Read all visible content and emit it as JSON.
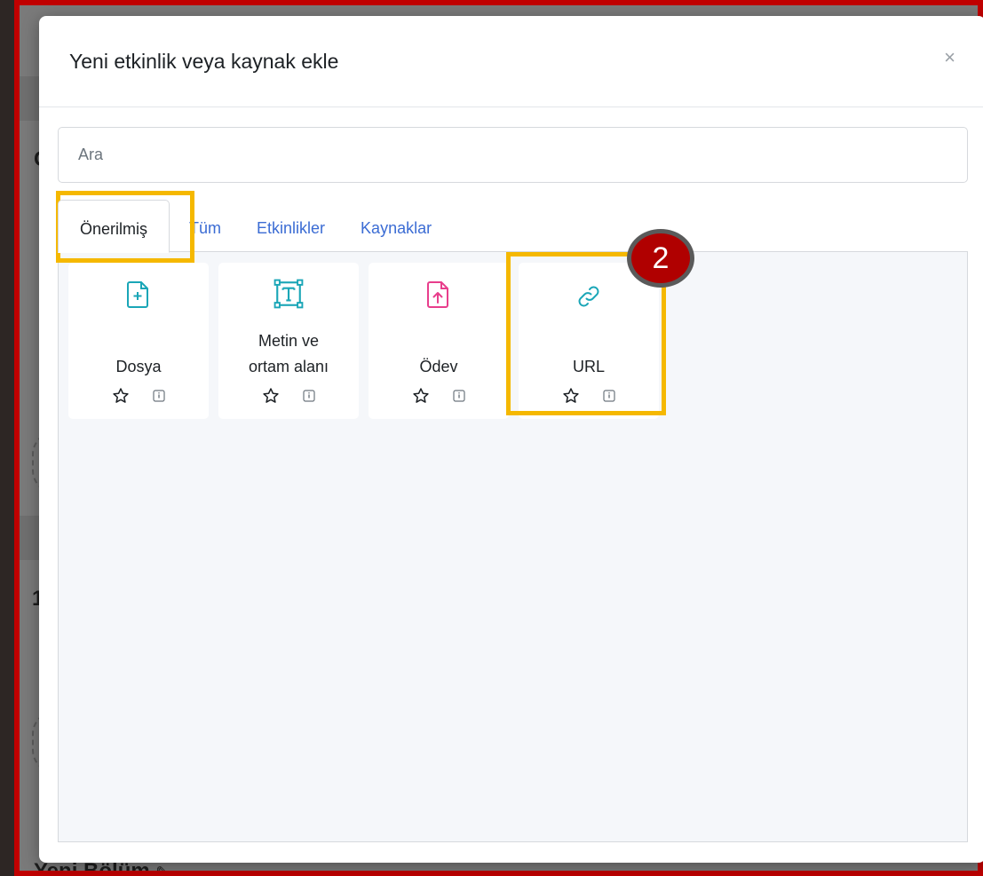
{
  "modal": {
    "title": "Yeni etkinlik veya kaynak ekle",
    "close_label": "×",
    "search_placeholder": "Ara"
  },
  "tabs": [
    {
      "label": "Önerilmiş",
      "active": true
    },
    {
      "label": "Tüm",
      "active": false
    },
    {
      "label": "Etkinlikler",
      "active": false
    },
    {
      "label": "Kaynaklar",
      "active": false
    }
  ],
  "tiles": [
    {
      "name": "Dosya",
      "icon": "file-plus-icon",
      "color": "#1aa6b7"
    },
    {
      "name": "Metin ve ortam alanı",
      "name_line1": "Metin ve",
      "name_line2": "ortam alanı",
      "icon": "text-frame-icon",
      "color": "#1aa6b7"
    },
    {
      "name": "Ödev",
      "icon": "file-upload-icon",
      "color": "#e83e8c"
    },
    {
      "name": "URL",
      "icon": "link-icon",
      "color": "#1aa6b7"
    }
  ],
  "annotation": {
    "step_number": "2",
    "highlight_color": "#f5b800",
    "badge_color": "#b00000"
  },
  "background": {
    "partial_letter_g": "G",
    "partial_number_1": "1",
    "bottom_text": "Yeni Bölüm",
    "pencil_icon": "pencil-icon"
  },
  "colors": {
    "accent": "#3b6cd4",
    "frame": "#c00000"
  }
}
